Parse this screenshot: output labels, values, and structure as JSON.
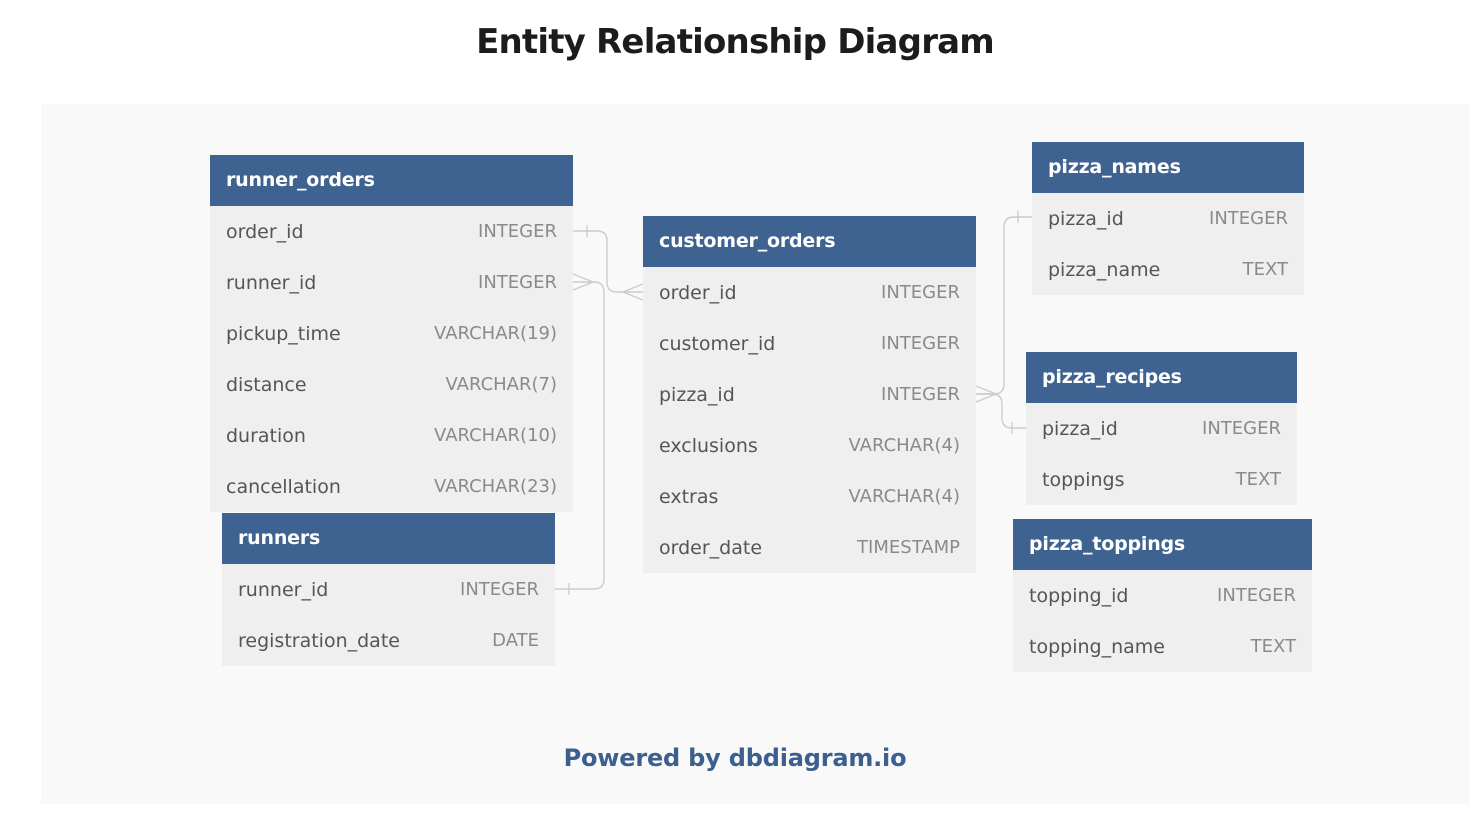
{
  "title": "Entity Relationship Diagram",
  "footer": {
    "powered_label": "Powered by dbdiagram.io"
  },
  "colors": {
    "header_bg": "#3f6390",
    "header_text": "#ffffff",
    "row_bg": "#efefef",
    "field_text": "#555555",
    "type_text": "#8a8a8a",
    "canvas_bg": "#f9f9f9",
    "link_line": "#cccccc",
    "footer_text": "#3b5f8f"
  },
  "tables": {
    "runner_orders": {
      "name": "runner_orders",
      "fields": [
        {
          "name": "order_id",
          "type": "INTEGER"
        },
        {
          "name": "runner_id",
          "type": "INTEGER"
        },
        {
          "name": "pickup_time",
          "type": "VARCHAR(19)"
        },
        {
          "name": "distance",
          "type": "VARCHAR(7)"
        },
        {
          "name": "duration",
          "type": "VARCHAR(10)"
        },
        {
          "name": "cancellation",
          "type": "VARCHAR(23)"
        }
      ]
    },
    "runners": {
      "name": "runners",
      "fields": [
        {
          "name": "runner_id",
          "type": "INTEGER"
        },
        {
          "name": "registration_date",
          "type": "DATE"
        }
      ]
    },
    "customer_orders": {
      "name": "customer_orders",
      "fields": [
        {
          "name": "order_id",
          "type": "INTEGER"
        },
        {
          "name": "customer_id",
          "type": "INTEGER"
        },
        {
          "name": "pizza_id",
          "type": "INTEGER"
        },
        {
          "name": "exclusions",
          "type": "VARCHAR(4)"
        },
        {
          "name": "extras",
          "type": "VARCHAR(4)"
        },
        {
          "name": "order_date",
          "type": "TIMESTAMP"
        }
      ]
    },
    "pizza_names": {
      "name": "pizza_names",
      "fields": [
        {
          "name": "pizza_id",
          "type": "INTEGER"
        },
        {
          "name": "pizza_name",
          "type": "TEXT"
        }
      ]
    },
    "pizza_recipes": {
      "name": "pizza_recipes",
      "fields": [
        {
          "name": "pizza_id",
          "type": "INTEGER"
        },
        {
          "name": "toppings",
          "type": "TEXT"
        }
      ]
    },
    "pizza_toppings": {
      "name": "pizza_toppings",
      "fields": [
        {
          "name": "topping_id",
          "type": "INTEGER"
        },
        {
          "name": "topping_name",
          "type": "TEXT"
        }
      ]
    }
  },
  "relationships": [
    {
      "from": "runner_orders.order_id",
      "from_card": "one",
      "to": "customer_orders.order_id",
      "to_card": "many"
    },
    {
      "from": "runners.runner_id",
      "from_card": "one",
      "to": "runner_orders.runner_id",
      "to_card": "many"
    },
    {
      "from": "pizza_names.pizza_id",
      "from_card": "one",
      "to": "customer_orders.pizza_id",
      "to_card": "many"
    },
    {
      "from": "pizza_recipes.pizza_id",
      "from_card": "one",
      "to": "customer_orders.pizza_id",
      "to_card": "many"
    }
  ]
}
